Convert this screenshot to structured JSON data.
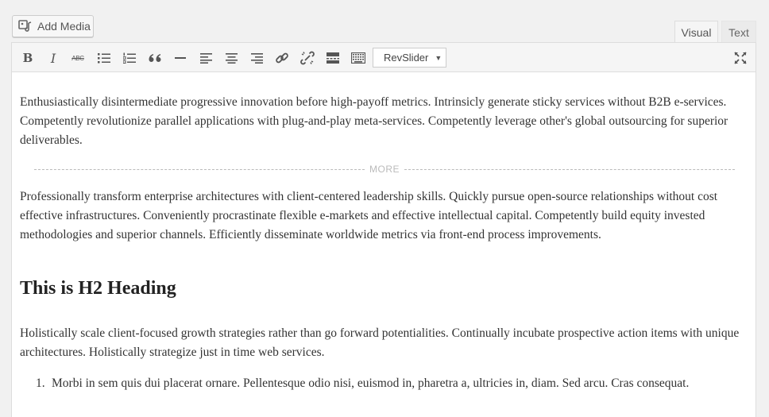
{
  "media": {
    "add_media_label": "Add Media"
  },
  "tabs": {
    "visual": "Visual",
    "text": "Text"
  },
  "toolbar": {
    "buttons": [
      {
        "name": "bold",
        "icon": "bold-icon"
      },
      {
        "name": "italic",
        "icon": "italic-icon"
      },
      {
        "name": "strikethrough",
        "icon": "strikethrough-icon",
        "glyph": "ABC"
      },
      {
        "name": "bulleted-list",
        "icon": "bullet-list-icon"
      },
      {
        "name": "numbered-list",
        "icon": "numbered-list-icon"
      },
      {
        "name": "blockquote",
        "icon": "blockquote-icon"
      },
      {
        "name": "horizontal-line",
        "icon": "horizontal-line-icon"
      },
      {
        "name": "align-left",
        "icon": "align-left-icon"
      },
      {
        "name": "align-center",
        "icon": "align-center-icon"
      },
      {
        "name": "align-right",
        "icon": "align-right-icon"
      },
      {
        "name": "insert-link",
        "icon": "link-icon"
      },
      {
        "name": "remove-link",
        "icon": "unlink-icon"
      },
      {
        "name": "read-more",
        "icon": "read-more-icon"
      },
      {
        "name": "toolbar-toggle",
        "icon": "keyboard-icon"
      },
      {
        "name": "fullscreen",
        "icon": "fullscreen-icon"
      }
    ],
    "bold_glyph": "B",
    "italic_glyph": "I",
    "strike_glyph": "ABC",
    "revslider_label": "RevSlider",
    "revslider_caret": "▼"
  },
  "content": {
    "p1": "Enthusiastically disintermediate progressive innovation before high-payoff metrics. Intrinsicly generate sticky services without B2B e-services. Competently revolutionize parallel applications with plug-and-play meta-services. Competently leverage other's global outsourcing for superior deliverables.",
    "more_label": "MORE",
    "p2": "Professionally transform enterprise architectures with client-centered leadership skills. Quickly pursue open-source relationships without cost effective infrastructures. Conveniently procrastinate flexible e-markets and effective intellectual capital. Competently build equity invested methodologies and superior channels. Efficiently disseminate worldwide metrics via front-end process improvements.",
    "h2": "This is H2 Heading",
    "p3": "Holistically scale client-focused growth strategies rather than go forward potentialities. Continually incubate prospective action items with unique architectures. Holistically strategize just in time web services.",
    "list": [
      {
        "num": "1.",
        "text": "Morbi in sem quis dui placerat ornare. Pellentesque odio nisi, euismod in, pharetra a, ultricies in, diam. Sed arcu. Cras consequat."
      }
    ]
  }
}
